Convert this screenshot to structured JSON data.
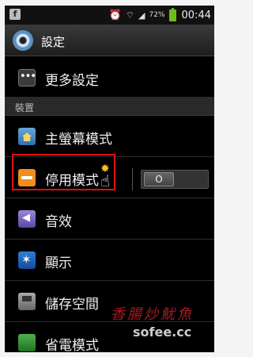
{
  "statusbar": {
    "battery_pct": "72%",
    "time": "00:44"
  },
  "header": {
    "title": "設定"
  },
  "more_settings": {
    "label": "更多設定"
  },
  "section": {
    "label": "裝置"
  },
  "items": [
    {
      "label": "主螢幕模式",
      "icon": "home-icon"
    },
    {
      "label": "停用模式",
      "icon": "block-icon"
    },
    {
      "label": "音效",
      "icon": "sound-icon"
    },
    {
      "label": "顯示",
      "icon": "display-icon"
    },
    {
      "label": "儲存空間",
      "icon": "storage-icon"
    },
    {
      "label": "省電模式",
      "icon": "battery-icon"
    }
  ],
  "toggle": {
    "state_label": "O"
  },
  "watermark": {
    "brand": "香腸炒魷魚",
    "url": "sofee.cc"
  },
  "colors": {
    "accent_toggle": "#6bbd1d",
    "highlight": "#e01010"
  }
}
